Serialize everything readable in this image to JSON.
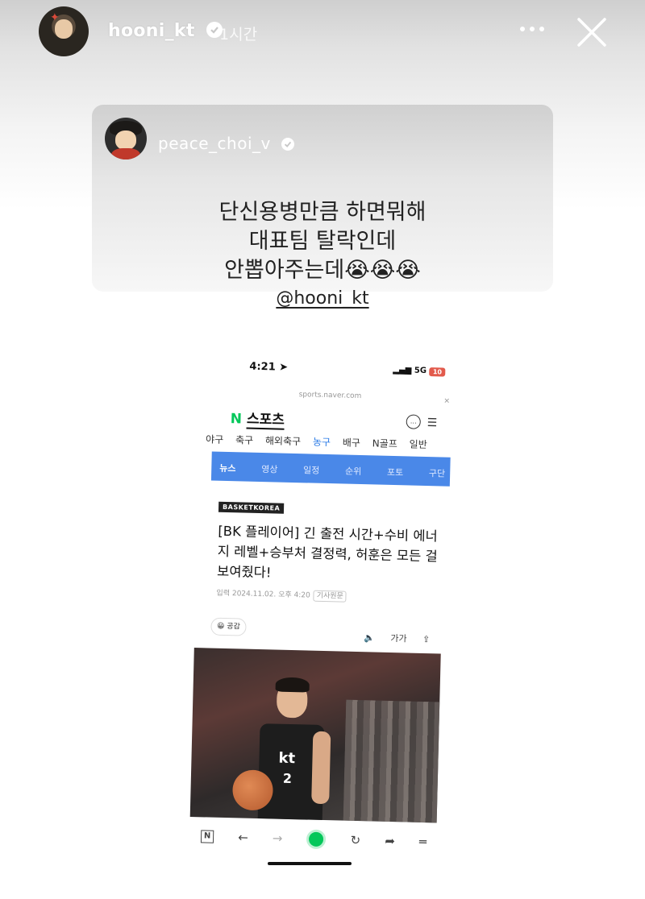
{
  "story": {
    "username": "hooni_kt",
    "time": "1시간"
  },
  "shared_post": {
    "username": "peace_choi_v",
    "text_lines": [
      "단신용병만큼 하면뭐해",
      "대표팀 탈락인데",
      "안뽑아주는데😭😭😭"
    ],
    "mention": "@hooni_kt"
  },
  "screenshot": {
    "status_time": "4:21",
    "network": "5G",
    "battery": "10",
    "url": "sports.naver.com",
    "logo_n": "N",
    "logo_text": "스포츠",
    "sport_tabs": [
      "야구",
      "축구",
      "해외축구",
      "농구",
      "배구",
      "N골프",
      "일반"
    ],
    "active_sport_tab": "농구",
    "section_tabs": [
      "뉴스",
      "영상",
      "일정",
      "순위",
      "포토",
      "구단"
    ],
    "source": "BASKETKOREA",
    "headline": "[BK 플레이어] 긴 출전 시간+수비 에너지 레벨+승부처 결정력, 허훈은 모든 걸 보여줬다!",
    "date": "입력 2024.11.02. 오후 4:20",
    "original_label": "기사원문",
    "reaction": "공감",
    "tools": [
      "🔈",
      "가가"
    ],
    "photo": {
      "jersey_logo": "kt",
      "jersey_number": "2"
    }
  },
  "colors": {
    "accent_blue": "#4a88e8",
    "naver_green": "#03c75a"
  }
}
